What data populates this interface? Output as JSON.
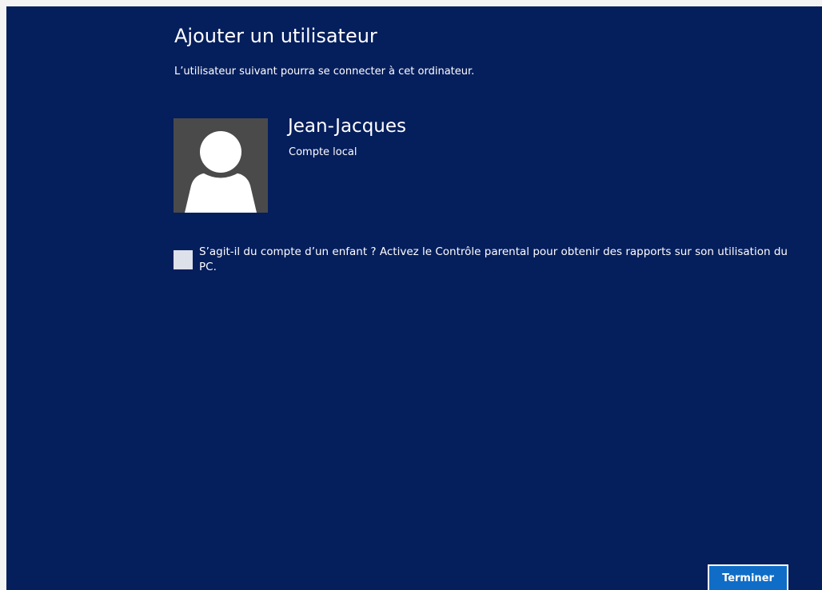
{
  "page": {
    "title": "Ajouter un utilisateur",
    "subtitle": "L’utilisateur suivant pourra se connecter à cet ordinateur."
  },
  "user": {
    "name": "Jean-Jacques",
    "account_type": "Compte local",
    "avatar_icon": "user-silhouette-icon"
  },
  "parental_control": {
    "checked": false,
    "label": "S’agit-il du compte d’un enfant ? Activez le Contrôle parental pour obtenir des rapports sur son utilisation du PC."
  },
  "actions": {
    "finish_label": "Terminer"
  },
  "colors": {
    "background": "#051e5c",
    "avatar_background": "#4a4a4a",
    "button_accent": "#0f6dc7",
    "text": "#ffffff"
  }
}
